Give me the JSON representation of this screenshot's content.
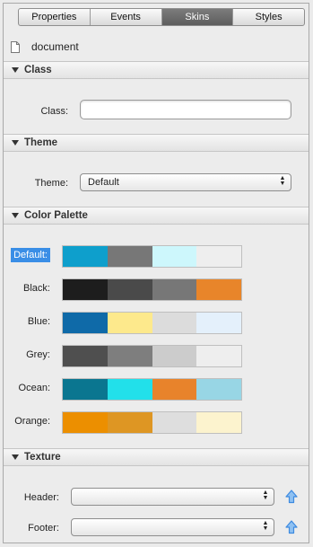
{
  "tabs": [
    {
      "label": "Properties",
      "active": false
    },
    {
      "label": "Events",
      "active": false
    },
    {
      "label": "Skins",
      "active": true
    },
    {
      "label": "Styles",
      "active": false
    }
  ],
  "document": {
    "label": "document"
  },
  "sections": {
    "class": "Class",
    "theme": "Theme",
    "color_palette": "Color Palette",
    "texture": "Texture"
  },
  "class_field": {
    "label": "Class:",
    "value": ""
  },
  "theme_field": {
    "label": "Theme:",
    "value": "Default"
  },
  "palettes": [
    {
      "label": "Default:",
      "selected": true,
      "colors": [
        "#0e9fcc",
        "#777777",
        "#cdf7fc",
        "#eeeeee"
      ]
    },
    {
      "label": "Black:",
      "selected": false,
      "colors": [
        "#1d1d1d",
        "#4a4a4a",
        "#777777",
        "#e8852a"
      ]
    },
    {
      "label": "Blue:",
      "selected": false,
      "colors": [
        "#0f6aa8",
        "#fde98c",
        "#dcdcdc",
        "#e4f0fb"
      ]
    },
    {
      "label": "Grey:",
      "selected": false,
      "colors": [
        "#4f4f4f",
        "#7e7e7e",
        "#cccccc",
        "#eeeeee"
      ]
    },
    {
      "label": "Ocean:",
      "selected": false,
      "colors": [
        "#0a7690",
        "#22e0ea",
        "#e8832b",
        "#98d6e5"
      ]
    },
    {
      "label": "Orange:",
      "selected": false,
      "colors": [
        "#ec8f00",
        "#de9623",
        "#dedede",
        "#fcf3ce"
      ]
    }
  ],
  "texture": {
    "header_label": "Header:",
    "header_value": "",
    "footer_label": "Footer:",
    "footer_value": ""
  },
  "colors": {
    "selection": "#3a8ee6",
    "upload_arrow": "#3d8ae0"
  }
}
